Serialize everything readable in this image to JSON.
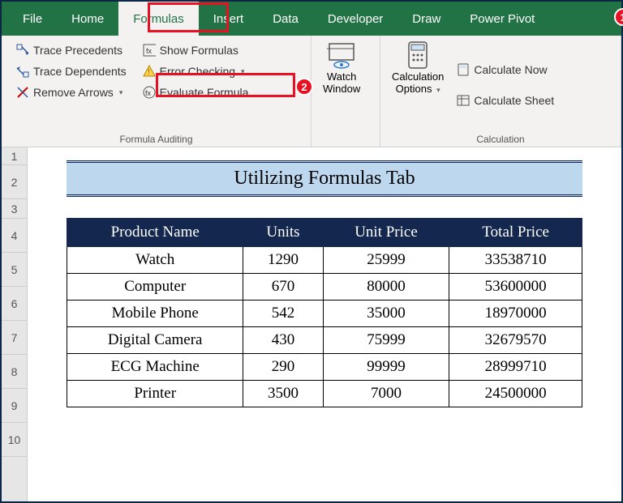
{
  "tabs": {
    "file": "File",
    "home": "Home",
    "formulas": "Formulas",
    "insert": "Insert",
    "data": "Data",
    "developer": "Developer",
    "draw": "Draw",
    "powerpivot": "Power Pivot"
  },
  "callouts": {
    "one": "1",
    "two": "2"
  },
  "ribbon": {
    "audit": {
      "trace_precedents": "Trace Precedents",
      "trace_dependents": "Trace Dependents",
      "remove_arrows": "Remove Arrows",
      "show_formulas": "Show Formulas",
      "error_checking": "Error Checking",
      "evaluate_formula": "Evaluate Formula",
      "group_label": "Formula Auditing"
    },
    "watch": {
      "label_l1": "Watch",
      "label_l2": "Window"
    },
    "calc": {
      "options_l1": "Calculation",
      "options_l2": "Options",
      "now": "Calculate Now",
      "sheet": "Calculate Sheet",
      "group_label": "Calculation"
    }
  },
  "rows": [
    "1",
    "2",
    "3",
    "4",
    "5",
    "6",
    "7",
    "8",
    "9",
    "10"
  ],
  "title": "Utilizing Formulas Tab",
  "headers": {
    "product": "Product Name",
    "units": "Units",
    "unit_price": "Unit Price",
    "total": "Total Price"
  },
  "data": [
    {
      "product": "Watch",
      "units": "1290",
      "unit_price": "25999",
      "total": "33538710"
    },
    {
      "product": "Computer",
      "units": "670",
      "unit_price": "80000",
      "total": "53600000"
    },
    {
      "product": "Mobile Phone",
      "units": "542",
      "unit_price": "35000",
      "total": "18970000"
    },
    {
      "product": "Digital Camera",
      "units": "430",
      "unit_price": "75999",
      "total": "32679570"
    },
    {
      "product": "ECG Machine",
      "units": "290",
      "unit_price": "99999",
      "total": "28999710"
    },
    {
      "product": "Printer",
      "units": "3500",
      "unit_price": "7000",
      "total": "24500000"
    }
  ]
}
